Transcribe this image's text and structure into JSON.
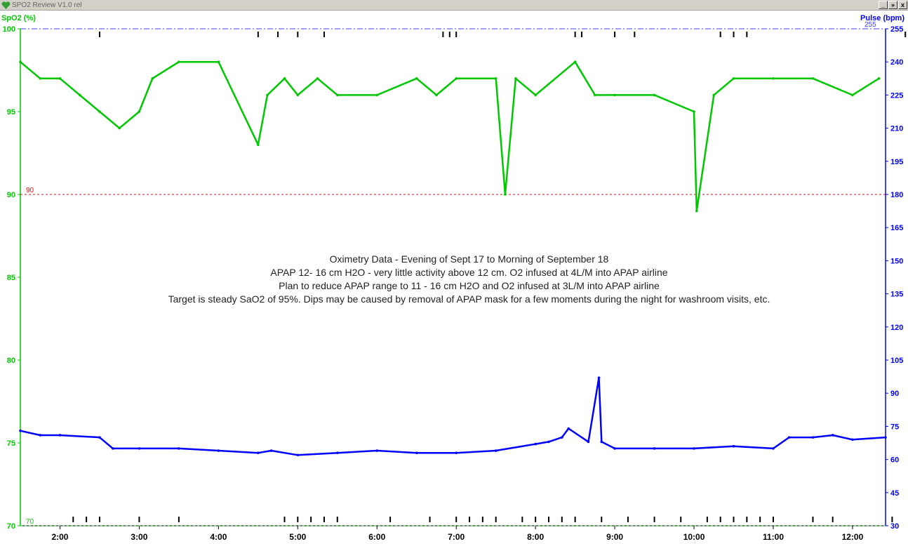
{
  "window": {
    "title": "SPO2 Review V1.0 rel",
    "buttons": [
      "_",
      "»",
      "x"
    ]
  },
  "chart_data": {
    "type": "line",
    "title": "",
    "left_axis": {
      "label": "SpO2 (%)",
      "range": [
        70,
        100
      ],
      "ticks": [
        "70",
        "75",
        "80",
        "85",
        "90",
        "95",
        "100"
      ]
    },
    "right_axis": {
      "label": "Pulse (bpm)",
      "range": [
        30,
        255
      ],
      "ticks": [
        "30",
        "45",
        "60",
        "75",
        "90",
        "105",
        "120",
        "135",
        "150",
        "165",
        "180",
        "195",
        "210",
        "225",
        "240",
        "255"
      ]
    },
    "x_axis": {
      "range": [
        "1:30",
        "12:25"
      ],
      "ticks": [
        "2:00",
        "3:00",
        "4:00",
        "5:00",
        "6:00",
        "7:00",
        "8:00",
        "9:00",
        "10:00",
        "11:00",
        "12:00"
      ]
    },
    "reference_lines": [
      {
        "label": "90",
        "axis": "left",
        "value": 90,
        "color": "#ff0000"
      },
      {
        "label": "255",
        "axis": "right",
        "value": 255,
        "color": "#4040ff"
      },
      {
        "label": "70",
        "axis": "left",
        "value": 70,
        "color": "#00c800"
      }
    ],
    "series": [
      {
        "axis": "left",
        "color": "#00c800",
        "x": [
          "1:30",
          "1:45",
          "2:00",
          "2:15",
          "2:30",
          "2:45",
          "3:00",
          "3:10",
          "3:30",
          "4:00",
          "4:30",
          "4:37",
          "4:50",
          "5:00",
          "5:15",
          "5:30",
          "6:00",
          "6:30",
          "6:45",
          "7:00",
          "7:30",
          "7:37",
          "7:45",
          "8:00",
          "8:30",
          "8:45",
          "9:00",
          "9:30",
          "10:00",
          "10:02",
          "10:15",
          "10:30",
          "11:00",
          "11:30",
          "12:00",
          "12:20"
        ],
        "values": [
          98,
          97,
          97,
          96,
          95,
          94,
          95,
          97,
          98,
          98,
          93,
          96,
          97,
          96,
          97,
          96,
          96,
          97,
          96,
          97,
          97,
          90,
          97,
          96,
          98,
          96,
          96,
          96,
          95,
          89,
          96,
          97,
          97,
          97,
          96,
          97
        ]
      },
      {
        "axis": "right",
        "color": "#0000ff",
        "x": [
          "1:30",
          "1:45",
          "2:00",
          "2:30",
          "2:40",
          "3:00",
          "3:30",
          "4:00",
          "4:30",
          "4:40",
          "5:00",
          "5:30",
          "6:00",
          "6:30",
          "7:00",
          "7:30",
          "8:00",
          "8:10",
          "8:20",
          "8:25",
          "8:40",
          "8:48",
          "8:50",
          "9:00",
          "9:30",
          "10:00",
          "10:30",
          "11:00",
          "11:12",
          "11:30",
          "11:45",
          "12:00",
          "12:25"
        ],
        "values": [
          73,
          71,
          71,
          70,
          65,
          65,
          65,
          64,
          63,
          64,
          62,
          63,
          64,
          63,
          63,
          64,
          67,
          68,
          70,
          74,
          68,
          97,
          68,
          65,
          65,
          65,
          66,
          65,
          70,
          70,
          71,
          69,
          70
        ]
      }
    ],
    "event_marks_top_x": [
      "2:30",
      "4:30",
      "4:45",
      "5:00",
      "5:20",
      "6:50",
      "6:55",
      "7:00",
      "8:30",
      "8:35",
      "9:00",
      "9:15",
      "10:20",
      "10:30",
      "10:40",
      "12:40"
    ],
    "event_marks_bottom_x": [
      "2:10",
      "2:20",
      "2:30",
      "3:00",
      "3:30",
      "4:50",
      "5:00",
      "5:10",
      "5:20",
      "5:30",
      "6:10",
      "6:40",
      "7:00",
      "7:10",
      "7:20",
      "7:30",
      "7:50",
      "8:00",
      "8:10",
      "8:20",
      "8:30",
      "8:50",
      "9:10",
      "9:30",
      "9:50",
      "10:10",
      "10:20",
      "10:30",
      "10:40",
      "10:50",
      "11:00",
      "11:30",
      "11:45",
      "12:30"
    ],
    "annotations": [
      "Oximetry Data - Evening of Sept 17 to Morning of September 18",
      "APAP 12- 16 cm H2O - very little activity above 12 cm.  O2 infused at 4L/M into APAP airline",
      "Plan to reduce APAP range to 11 - 16 cm H2O and O2 infused at 3L/M into APAP airline",
      "Target is steady SaO2 of 95%.  Dips may be caused by removal of APAP mask for a few moments during the night for washroom visits, etc."
    ]
  }
}
